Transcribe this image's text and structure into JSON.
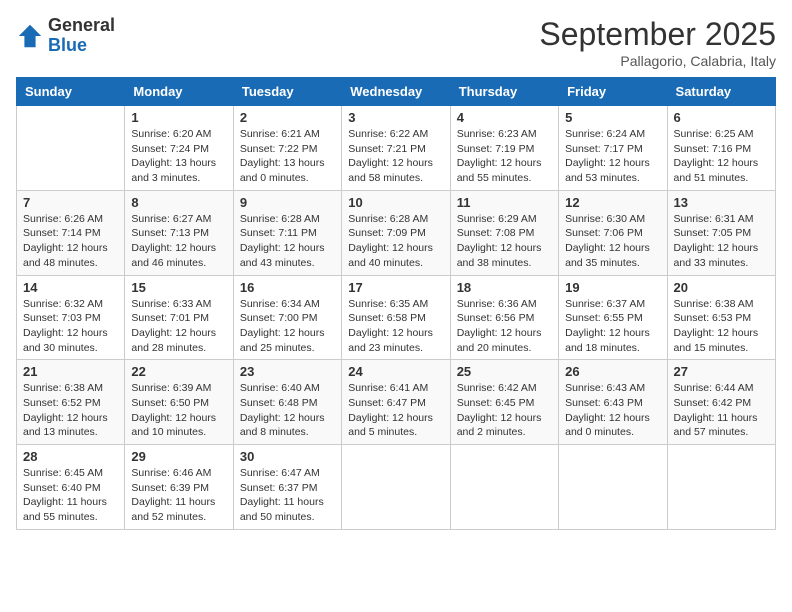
{
  "header": {
    "logo": {
      "general": "General",
      "blue": "Blue"
    },
    "title": "September 2025",
    "location": "Pallagorio, Calabria, Italy"
  },
  "days_of_week": [
    "Sunday",
    "Monday",
    "Tuesday",
    "Wednesday",
    "Thursday",
    "Friday",
    "Saturday"
  ],
  "weeks": [
    [
      {
        "day": "",
        "info": ""
      },
      {
        "day": "1",
        "info": "Sunrise: 6:20 AM\nSunset: 7:24 PM\nDaylight: 13 hours\nand 3 minutes."
      },
      {
        "day": "2",
        "info": "Sunrise: 6:21 AM\nSunset: 7:22 PM\nDaylight: 13 hours\nand 0 minutes."
      },
      {
        "day": "3",
        "info": "Sunrise: 6:22 AM\nSunset: 7:21 PM\nDaylight: 12 hours\nand 58 minutes."
      },
      {
        "day": "4",
        "info": "Sunrise: 6:23 AM\nSunset: 7:19 PM\nDaylight: 12 hours\nand 55 minutes."
      },
      {
        "day": "5",
        "info": "Sunrise: 6:24 AM\nSunset: 7:17 PM\nDaylight: 12 hours\nand 53 minutes."
      },
      {
        "day": "6",
        "info": "Sunrise: 6:25 AM\nSunset: 7:16 PM\nDaylight: 12 hours\nand 51 minutes."
      }
    ],
    [
      {
        "day": "7",
        "info": "Sunrise: 6:26 AM\nSunset: 7:14 PM\nDaylight: 12 hours\nand 48 minutes."
      },
      {
        "day": "8",
        "info": "Sunrise: 6:27 AM\nSunset: 7:13 PM\nDaylight: 12 hours\nand 46 minutes."
      },
      {
        "day": "9",
        "info": "Sunrise: 6:28 AM\nSunset: 7:11 PM\nDaylight: 12 hours\nand 43 minutes."
      },
      {
        "day": "10",
        "info": "Sunrise: 6:28 AM\nSunset: 7:09 PM\nDaylight: 12 hours\nand 40 minutes."
      },
      {
        "day": "11",
        "info": "Sunrise: 6:29 AM\nSunset: 7:08 PM\nDaylight: 12 hours\nand 38 minutes."
      },
      {
        "day": "12",
        "info": "Sunrise: 6:30 AM\nSunset: 7:06 PM\nDaylight: 12 hours\nand 35 minutes."
      },
      {
        "day": "13",
        "info": "Sunrise: 6:31 AM\nSunset: 7:05 PM\nDaylight: 12 hours\nand 33 minutes."
      }
    ],
    [
      {
        "day": "14",
        "info": "Sunrise: 6:32 AM\nSunset: 7:03 PM\nDaylight: 12 hours\nand 30 minutes."
      },
      {
        "day": "15",
        "info": "Sunrise: 6:33 AM\nSunset: 7:01 PM\nDaylight: 12 hours\nand 28 minutes."
      },
      {
        "day": "16",
        "info": "Sunrise: 6:34 AM\nSunset: 7:00 PM\nDaylight: 12 hours\nand 25 minutes."
      },
      {
        "day": "17",
        "info": "Sunrise: 6:35 AM\nSunset: 6:58 PM\nDaylight: 12 hours\nand 23 minutes."
      },
      {
        "day": "18",
        "info": "Sunrise: 6:36 AM\nSunset: 6:56 PM\nDaylight: 12 hours\nand 20 minutes."
      },
      {
        "day": "19",
        "info": "Sunrise: 6:37 AM\nSunset: 6:55 PM\nDaylight: 12 hours\nand 18 minutes."
      },
      {
        "day": "20",
        "info": "Sunrise: 6:38 AM\nSunset: 6:53 PM\nDaylight: 12 hours\nand 15 minutes."
      }
    ],
    [
      {
        "day": "21",
        "info": "Sunrise: 6:38 AM\nSunset: 6:52 PM\nDaylight: 12 hours\nand 13 minutes."
      },
      {
        "day": "22",
        "info": "Sunrise: 6:39 AM\nSunset: 6:50 PM\nDaylight: 12 hours\nand 10 minutes."
      },
      {
        "day": "23",
        "info": "Sunrise: 6:40 AM\nSunset: 6:48 PM\nDaylight: 12 hours\nand 8 minutes."
      },
      {
        "day": "24",
        "info": "Sunrise: 6:41 AM\nSunset: 6:47 PM\nDaylight: 12 hours\nand 5 minutes."
      },
      {
        "day": "25",
        "info": "Sunrise: 6:42 AM\nSunset: 6:45 PM\nDaylight: 12 hours\nand 2 minutes."
      },
      {
        "day": "26",
        "info": "Sunrise: 6:43 AM\nSunset: 6:43 PM\nDaylight: 12 hours\nand 0 minutes."
      },
      {
        "day": "27",
        "info": "Sunrise: 6:44 AM\nSunset: 6:42 PM\nDaylight: 11 hours\nand 57 minutes."
      }
    ],
    [
      {
        "day": "28",
        "info": "Sunrise: 6:45 AM\nSunset: 6:40 PM\nDaylight: 11 hours\nand 55 minutes."
      },
      {
        "day": "29",
        "info": "Sunrise: 6:46 AM\nSunset: 6:39 PM\nDaylight: 11 hours\nand 52 minutes."
      },
      {
        "day": "30",
        "info": "Sunrise: 6:47 AM\nSunset: 6:37 PM\nDaylight: 11 hours\nand 50 minutes."
      },
      {
        "day": "",
        "info": ""
      },
      {
        "day": "",
        "info": ""
      },
      {
        "day": "",
        "info": ""
      },
      {
        "day": "",
        "info": ""
      }
    ]
  ]
}
